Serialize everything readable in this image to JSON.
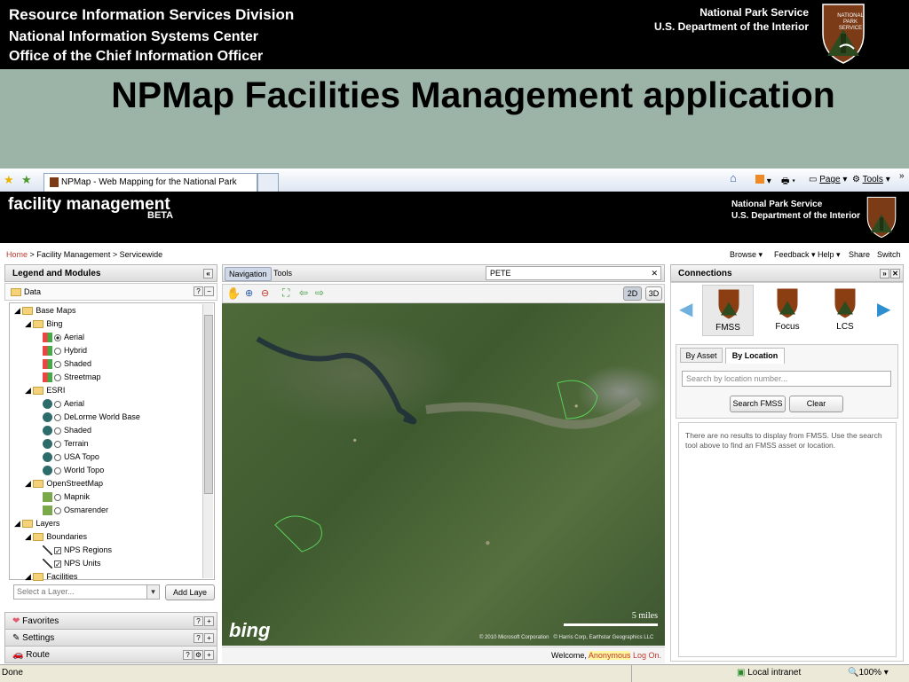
{
  "slide": {
    "division": "Resource Information Services Division",
    "center": "National Information Systems Center",
    "office": "Office of the Chief Information Officer",
    "agency": "National Park Service",
    "department": "U.S. Department of the Interior",
    "title": "NPMap Facilities Management application",
    "logo_text": "NATIONAL PARK SERVICE"
  },
  "browser": {
    "tab_title": "NPMap - Web Mapping for the National Park Service",
    "page_menu": "Page",
    "tools_menu": "Tools",
    "status": "Done",
    "zone": "Local intranet",
    "zoom": "100%"
  },
  "app": {
    "title": "facility management",
    "beta": "BETA",
    "agency": "National Park Service",
    "department": "U.S. Department of the Interior",
    "breadcrumb": {
      "home": "Home",
      "sep": " > ",
      "section": "Facility Management",
      "page": "Servicewide"
    },
    "topnav": [
      "Browse ▾",
      "Feedback ▾",
      "Help ▾",
      "Share",
      "Switch"
    ]
  },
  "left": {
    "header": "Legend and Modules",
    "data_label": "Data",
    "tree": {
      "base_maps": "Base Maps",
      "bing": "Bing",
      "bing_items": [
        "Aerial",
        "Hybrid",
        "Shaded",
        "Streetmap"
      ],
      "esri": "ESRI",
      "esri_items": [
        "Aerial",
        "DeLorme World Base",
        "Shaded",
        "Terrain",
        "USA Topo",
        "World Topo"
      ],
      "osm": "OpenStreetMap",
      "osm_items": [
        "Mapnik",
        "Osmarender"
      ],
      "layers": "Layers",
      "boundaries": "Boundaries",
      "boundary_items": [
        "NPS Regions",
        "NPS Units"
      ],
      "facilities": "Facilities"
    },
    "select_placeholder": "Select a Layer...",
    "add_layer": "Add Laye",
    "favorites": "Favorites",
    "settings": "Settings",
    "route": "Route"
  },
  "map": {
    "tab_navigation": "Navigation",
    "tab_tools": "Tools",
    "search_value": "PETE",
    "btn_2d": "2D",
    "btn_3d": "3D",
    "scale": "5 miles",
    "bing_logo": "bing",
    "copyright1": "© 2010 Microsoft Corporation",
    "copyright2": "© Harris Corp, Earthstar Geographics LLC",
    "welcome": "Welcome,",
    "user": "Anonymous",
    "logon": "Log On."
  },
  "right": {
    "header": "Connections",
    "apps": [
      "FMSS",
      "Focus",
      "LCS"
    ],
    "tab_asset": "By Asset",
    "tab_location": "By Location",
    "search_placeholder": "Search by location number...",
    "search_btn": "Search FMSS",
    "clear_btn": "Clear",
    "message": "There are no results to display from FMSS. Use the search tool above to find an FMSS asset or location."
  }
}
